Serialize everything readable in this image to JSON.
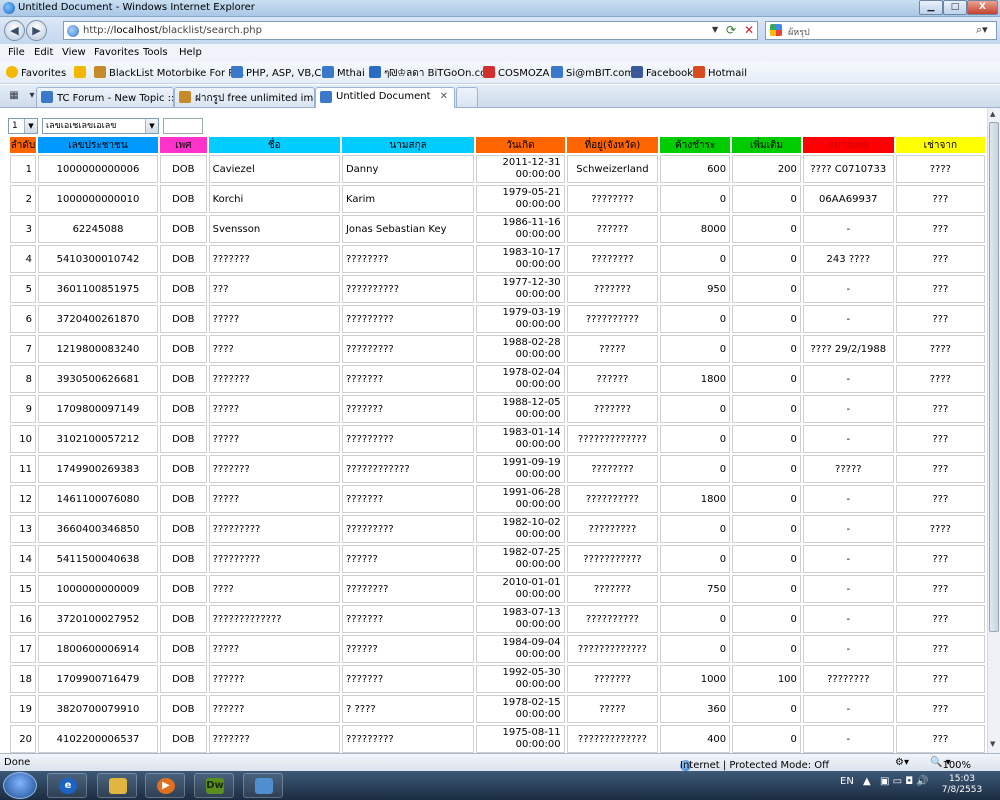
{
  "window": {
    "title": "Untitled Document - Windows Internet Explorer",
    "min": "▁",
    "max": "□",
    "close": "X"
  },
  "address": {
    "prefix": "http://",
    "host": "localhost",
    "path": "/blacklist/search.php",
    "search_text": "ผ้หรุป"
  },
  "menu": [
    "File",
    "Edit",
    "View",
    "Favorites",
    "Tools",
    "Help"
  ],
  "favorites": {
    "label": "Favorites",
    "items": [
      {
        "label": "BlackList Motorbike For R...",
        "color": "#c58a2a"
      },
      {
        "label": "PHP, ASP, VB,C#",
        "color": "#3a78c9"
      },
      {
        "label": "Mthai",
        "color": "#3a78c9"
      },
      {
        "label": "ๆ₪♔ลดา BiTGoOn.com",
        "color": "#2a6bc2"
      },
      {
        "label": "COSMOZA",
        "color": "#d32f2f"
      },
      {
        "label": "Si@mBIT.com",
        "color": "#3a78c9"
      },
      {
        "label": "Facebook",
        "color": "#3b5998"
      },
      {
        "label": "Hotmail",
        "color": "#d84b1e"
      }
    ]
  },
  "tabs": [
    {
      "label": "TC Forum - New Topic :: ร...",
      "color": "#3a78c9"
    },
    {
      "label": "ฝากรูป free unlimited imag...",
      "color": "#c58a2a"
    },
    {
      "label": "Untitled Document",
      "color": "#3a78c9"
    }
  ],
  "controls": {
    "count_select": "1",
    "search_by_select": "เลขเอเชเลขเอเลข"
  },
  "table": {
    "headers": [
      {
        "label": "ลำดับ",
        "bg": "#ff6600",
        "fg": "#000000"
      },
      {
        "label": "เลขประชาชน",
        "bg": "#0099ff",
        "fg": "#000000"
      },
      {
        "label": "เพศ",
        "bg": "#ff33cc",
        "fg": "#000000"
      },
      {
        "label": "ชื่อ",
        "bg": "#00ccff",
        "fg": "#000000"
      },
      {
        "label": "นามสกุล",
        "bg": "#00ccff",
        "fg": "#000000"
      },
      {
        "label": "วันเกิด",
        "bg": "#ff6600",
        "fg": "#000000"
      },
      {
        "label": "ที่อยู่(จังหวัด)",
        "bg": "#ff6600",
        "fg": "#000000"
      },
      {
        "label": "ค้างชำระ",
        "bg": "#00cc00",
        "fg": "#000000"
      },
      {
        "label": "เพิ่มเติม",
        "bg": "#00cc00",
        "fg": "#000000"
      },
      {
        "label": "หมายเหตุ",
        "bg": "#ff0000",
        "fg": "#cc0000"
      },
      {
        "label": "เช่าจาก",
        "bg": "#ffff00",
        "fg": "#000000"
      }
    ],
    "rows": [
      {
        "no": "1",
        "id": "1000000000006",
        "sex": "DOB",
        "first": "Caviezel",
        "last": "Danny",
        "date": "2011-12-31",
        "time": "00:00:00",
        "addr": "Schweizerland",
        "owe": "600",
        "extra": "200",
        "note": "???? C0710733",
        "from": "????"
      },
      {
        "no": "2",
        "id": "1000000000010",
        "sex": "DOB",
        "first": "Korchi",
        "last": "Karim",
        "date": "1979-05-21",
        "time": "00:00:00",
        "addr": "????????",
        "owe": "0",
        "extra": "0",
        "note": "06AA69937",
        "from": "???"
      },
      {
        "no": "3",
        "id": "62245088",
        "sex": "DOB",
        "first": "Svensson",
        "last": "Jonas Sebastian Key",
        "date": "1986-11-16",
        "time": "00:00:00",
        "addr": "??????",
        "owe": "8000",
        "extra": "0",
        "note": "-",
        "from": "???"
      },
      {
        "no": "4",
        "id": "5410300010742",
        "sex": "DOB",
        "first": "???????",
        "last": "????????",
        "date": "1983-10-17",
        "time": "00:00:00",
        "addr": "????????",
        "owe": "0",
        "extra": "0",
        "note": "243 ????",
        "from": "???"
      },
      {
        "no": "5",
        "id": "3601100851975",
        "sex": "DOB",
        "first": "???",
        "last": "??????????",
        "date": "1977-12-30",
        "time": "00:00:00",
        "addr": "???????",
        "owe": "950",
        "extra": "0",
        "note": "-",
        "from": "???"
      },
      {
        "no": "6",
        "id": "3720400261870",
        "sex": "DOB",
        "first": "?????",
        "last": "?????????",
        "date": "1979-03-19",
        "time": "00:00:00",
        "addr": "??????????",
        "owe": "0",
        "extra": "0",
        "note": "-",
        "from": "???"
      },
      {
        "no": "7",
        "id": "1219800083240",
        "sex": "DOB",
        "first": "????",
        "last": "?????????",
        "date": "1988-02-28",
        "time": "00:00:00",
        "addr": "?????",
        "owe": "0",
        "extra": "0",
        "note": "???? 29/2/1988",
        "from": "????"
      },
      {
        "no": "8",
        "id": "3930500626681",
        "sex": "DOB",
        "first": "???????",
        "last": "???????",
        "date": "1978-02-04",
        "time": "00:00:00",
        "addr": "??????",
        "owe": "1800",
        "extra": "0",
        "note": "-",
        "from": "????"
      },
      {
        "no": "9",
        "id": "1709800097149",
        "sex": "DOB",
        "first": "?????",
        "last": "???????",
        "date": "1988-12-05",
        "time": "00:00:00",
        "addr": "???????",
        "owe": "0",
        "extra": "0",
        "note": "-",
        "from": "???"
      },
      {
        "no": "10",
        "id": "3102100057212",
        "sex": "DOB",
        "first": "?????",
        "last": "?????????",
        "date": "1983-01-14",
        "time": "00:00:00",
        "addr": "?????????????",
        "owe": "0",
        "extra": "0",
        "note": "-",
        "from": "???"
      },
      {
        "no": "11",
        "id": "1749900269383",
        "sex": "DOB",
        "first": "???????",
        "last": "????????????",
        "date": "1991-09-19",
        "time": "00:00:00",
        "addr": "????????",
        "owe": "0",
        "extra": "0",
        "note": "?????",
        "from": "???"
      },
      {
        "no": "12",
        "id": "1461100076080",
        "sex": "DOB",
        "first": "?????",
        "last": "???????",
        "date": "1991-06-28",
        "time": "00:00:00",
        "addr": "??????????",
        "owe": "1800",
        "extra": "0",
        "note": "-",
        "from": "???"
      },
      {
        "no": "13",
        "id": "3660400346850",
        "sex": "DOB",
        "first": "?????????",
        "last": "?????????",
        "date": "1982-10-02",
        "time": "00:00:00",
        "addr": "?????????",
        "owe": "0",
        "extra": "0",
        "note": "-",
        "from": "????"
      },
      {
        "no": "14",
        "id": "5411500040638",
        "sex": "DOB",
        "first": "?????????",
        "last": "??????",
        "date": "1982-07-25",
        "time": "00:00:00",
        "addr": "???????????",
        "owe": "0",
        "extra": "0",
        "note": "-",
        "from": "???"
      },
      {
        "no": "15",
        "id": "1000000000009",
        "sex": "DOB",
        "first": "????",
        "last": "????????",
        "date": "2010-01-01",
        "time": "00:00:00",
        "addr": "???????",
        "owe": "750",
        "extra": "0",
        "note": "-",
        "from": "???"
      },
      {
        "no": "16",
        "id": "3720100027952",
        "sex": "DOB",
        "first": "?????????????",
        "last": "???????",
        "date": "1983-07-13",
        "time": "00:00:00",
        "addr": "??????????",
        "owe": "0",
        "extra": "0",
        "note": "-",
        "from": "???"
      },
      {
        "no": "17",
        "id": "1800600006914",
        "sex": "DOB",
        "first": "?????",
        "last": "??????",
        "date": "1984-09-04",
        "time": "00:00:00",
        "addr": "?????????????",
        "owe": "0",
        "extra": "0",
        "note": "-",
        "from": "???"
      },
      {
        "no": "18",
        "id": "1709900716479",
        "sex": "DOB",
        "first": "??????",
        "last": "???????",
        "date": "1992-05-30",
        "time": "00:00:00",
        "addr": "???????",
        "owe": "1000",
        "extra": "100",
        "note": "????????",
        "from": "???"
      },
      {
        "no": "19",
        "id": "3820700079910",
        "sex": "DOB",
        "first": "??????",
        "last": "? ????",
        "date": "1978-02-15",
        "time": "00:00:00",
        "addr": "?????",
        "owe": "360",
        "extra": "0",
        "note": "-",
        "from": "???"
      },
      {
        "no": "20",
        "id": "4102200006537",
        "sex": "DOB",
        "first": "???????",
        "last": "?????????",
        "date": "1975-08-11",
        "time": "00:00:00",
        "addr": "?????????????",
        "owe": "400",
        "extra": "0",
        "note": "-",
        "from": "???"
      }
    ]
  },
  "status": {
    "left": "Done",
    "zone": "Internet | Protected Mode: Off",
    "zoom": "100%"
  },
  "taskbar": {
    "dw_label": "Dw",
    "lang": "EN",
    "time": "15:03",
    "date": "7/8/2553"
  }
}
